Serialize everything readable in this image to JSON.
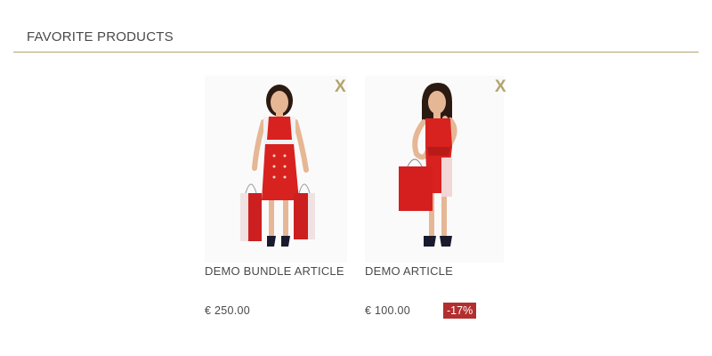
{
  "section": {
    "title": "FAVORITE PRODUCTS"
  },
  "products": [
    {
      "name": "DEMO BUNDLE ARTICLE",
      "price": "€ 250.00",
      "remove_label": "X",
      "image": "woman in red dress with shopping bags"
    },
    {
      "name": "DEMO ARTICLE",
      "price": "€ 100.00",
      "discount": "-17%",
      "remove_label": "X",
      "image": "woman in red wrap dress holding red shopping bag"
    }
  ],
  "colors": {
    "accent": "#b3a46f",
    "discount_badge": "#b32f2f",
    "dress_red": "#d8221f"
  }
}
